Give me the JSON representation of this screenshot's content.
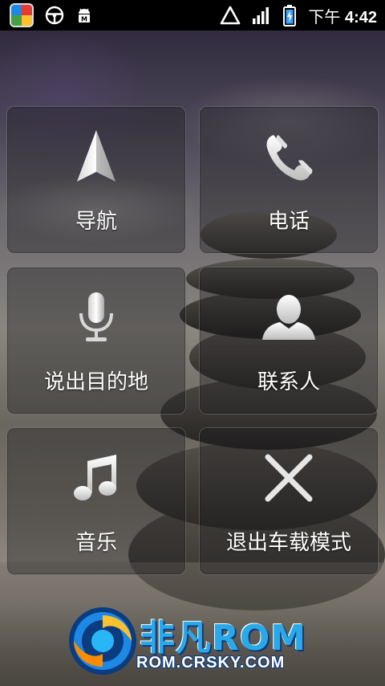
{
  "status_bar": {
    "icons": [
      "app-badge-icon",
      "steering-wheel-icon",
      "android-debug-icon",
      "wifi-triangle-icon",
      "signal-icon",
      "battery-charging-icon"
    ],
    "clock_prefix": "下午",
    "clock_time": "4:42"
  },
  "car_home": {
    "tiles": [
      {
        "label": "导航",
        "icon": "navigation-arrow-icon"
      },
      {
        "label": "电话",
        "icon": "phone-handset-icon"
      },
      {
        "label": "说出目的地",
        "icon": "microphone-icon"
      },
      {
        "label": "联系人",
        "icon": "contact-person-icon"
      },
      {
        "label": "音乐",
        "icon": "music-note-icon"
      },
      {
        "label": "退出车载模式",
        "icon": "close-x-icon"
      }
    ]
  },
  "watermark": {
    "brand": "非凡ROM",
    "url": "ROM.CRSKY.COM"
  },
  "colors": {
    "status_bar_bg": "#000000",
    "tile_text": "#ffffff",
    "watermark_blue": "#2aa8e8",
    "watermark_green": "#8bd630"
  }
}
